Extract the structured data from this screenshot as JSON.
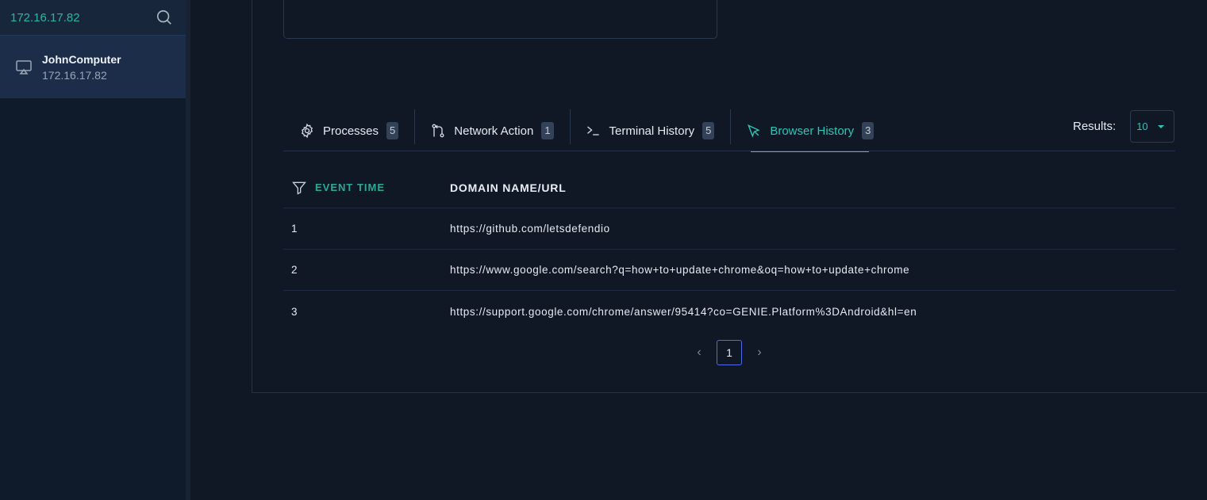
{
  "sidebar": {
    "search_value": "172.16.17.82",
    "host": {
      "name": "JohnComputer",
      "ip": "172.16.17.82"
    }
  },
  "tabs": [
    {
      "label": "Processes",
      "count": "5",
      "icon": "gear-icon"
    },
    {
      "label": "Network Action",
      "count": "1",
      "icon": "git-compare-icon"
    },
    {
      "label": "Terminal History",
      "count": "5",
      "icon": "terminal-icon"
    },
    {
      "label": "Browser History",
      "count": "3",
      "icon": "cursor-icon",
      "active": true
    }
  ],
  "results": {
    "label": "Results:",
    "value": "10"
  },
  "table": {
    "headers": {
      "event_time": "EVENT TIME",
      "domain": "DOMAIN NAME/URL"
    },
    "rows": [
      {
        "time": "1",
        "url": "https://github.com/letsdefendio"
      },
      {
        "time": "2",
        "url": "https://www.google.com/search?q=how+to+update+chrome&oq=how+to+update+chrome"
      },
      {
        "time": "3",
        "url": "https://support.google.com/chrome/answer/95414?co=GENIE.Platform%3DAndroid&hl=en"
      }
    ]
  },
  "pagination": {
    "prev": "‹",
    "current": "1",
    "next": "›"
  },
  "colors": {
    "accent": "#2ec4b6",
    "background": "#101725",
    "sidebar": "#0f1a2a",
    "active_page_border": "#4f6be8"
  }
}
